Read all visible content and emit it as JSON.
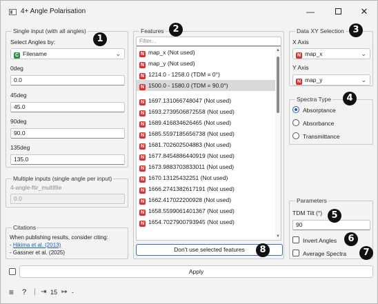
{
  "window": {
    "title": "4+ Angle Polarisation"
  },
  "single_input": {
    "group_title": "Single input (with all angles)",
    "select_label": "Select Angles by:",
    "select_value": "Filename",
    "select_badge": "C",
    "angles": [
      {
        "label": "0deg",
        "value": "0.0"
      },
      {
        "label": "45deg",
        "value": "45.0"
      },
      {
        "label": "90deg",
        "value": "90.0"
      },
      {
        "label": "135deg",
        "value": "135.0"
      }
    ]
  },
  "multiple_inputs": {
    "group_title": "Multiple inputs (single angle per input)",
    "name_label": "4-angle-ftir_multifile",
    "value": "0.0"
  },
  "citations": {
    "group_title": "Citations",
    "text": "When publishing results, consider citing:",
    "ref1_prefix": "- ",
    "ref1": "Hikima et al. (2013)",
    "ref2": "- Gassner et al. (2025)"
  },
  "features": {
    "group_title": "Features",
    "filter_placeholder": "Filter...",
    "badge": "N",
    "items": [
      "map_x (Not used)",
      "map_y (Not used)",
      "1214.0 - 1258.0 (TDM = 0°)",
      "1500.0 - 1580.0 (TDM = 90.0°)",
      "1697.131066748047 (Not used)",
      "1693.2739506872558 (Not used)",
      "1689.416834626465 (Not used)",
      "1685.5597185656738 (Not used)",
      "1681.702602504883 (Not used)",
      "1677.8454886440919 (Not used)",
      "1673.9883703833011 (Not used)",
      "1670.13125432251 (Not used)",
      "1666.2741382617191 (Not used)",
      "1662.417022200928 (Not used)",
      "1658.5599061401367 (Not used)",
      "1654.7027900793945 (Not used)"
    ],
    "button_label": "Don't use selected features"
  },
  "data_xy": {
    "group_title": "Data XY Selection",
    "x_label": "X Axis",
    "x_value": "map_x",
    "y_label": "Y Axis",
    "y_value": "map_y",
    "badge": "N"
  },
  "spectra_type": {
    "group_title": "Spectra Type",
    "options": [
      "Absorptance",
      "Absorbance",
      "Transmittance"
    ],
    "selected": "Absorptance"
  },
  "parameters": {
    "group_title": "Parameters",
    "tdm_label": "TDM Tilt (°)",
    "tdm_value": "90",
    "invert_label": "Invert Angles",
    "average_label": "Average Spectra"
  },
  "apply": {
    "label": "Apply"
  },
  "status_bar": {
    "help": "?",
    "input_count": "15",
    "output_text": "-"
  },
  "markers": [
    "1",
    "2",
    "3",
    "4",
    "5",
    "6",
    "7",
    "8"
  ],
  "colors": {
    "accent": "#1f5fb3",
    "badge_categorical": "#2f8f4a",
    "badge_numeric": "#d9322e",
    "selection": "#d9d9d9"
  }
}
